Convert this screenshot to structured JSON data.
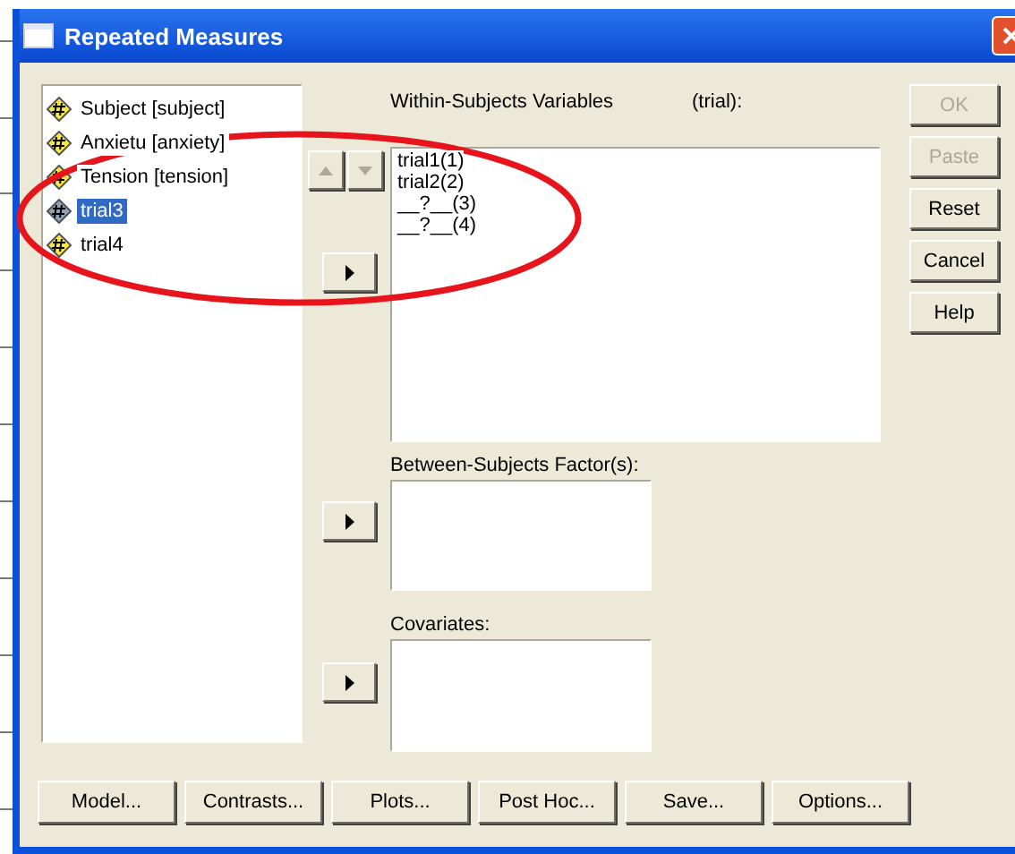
{
  "window": {
    "title": "Repeated Measures"
  },
  "variables": [
    {
      "label": "Subject [subject]",
      "selected": false
    },
    {
      "label": "Anxietu [anxiety]",
      "selected": false
    },
    {
      "label": "Tension [tension]",
      "selected": false
    },
    {
      "label": "trial3",
      "selected": true
    },
    {
      "label": "trial4",
      "selected": false
    }
  ],
  "reorder_buttons": [
    {
      "kind": "up",
      "disabled": true
    },
    {
      "kind": "down",
      "disabled": true
    }
  ],
  "within": {
    "label": "Within-Subjects Variables",
    "factor": "(trial):",
    "items": [
      "trial1(1)",
      "trial2(2)",
      "__?__(3)",
      "__?__(4)"
    ]
  },
  "between": {
    "label": "Between-Subjects Factor(s):"
  },
  "covariates": {
    "label": "Covariates:"
  },
  "side_buttons": [
    {
      "label": "OK",
      "disabled": true
    },
    {
      "label": "Paste",
      "disabled": true
    },
    {
      "label": "Reset",
      "disabled": false
    },
    {
      "label": "Cancel",
      "disabled": false
    },
    {
      "label": "Help",
      "disabled": false
    }
  ],
  "bottom_buttons": [
    "Model...",
    "Contrasts...",
    "Plots...",
    "Post Hoc...",
    "Save...",
    "Options..."
  ]
}
